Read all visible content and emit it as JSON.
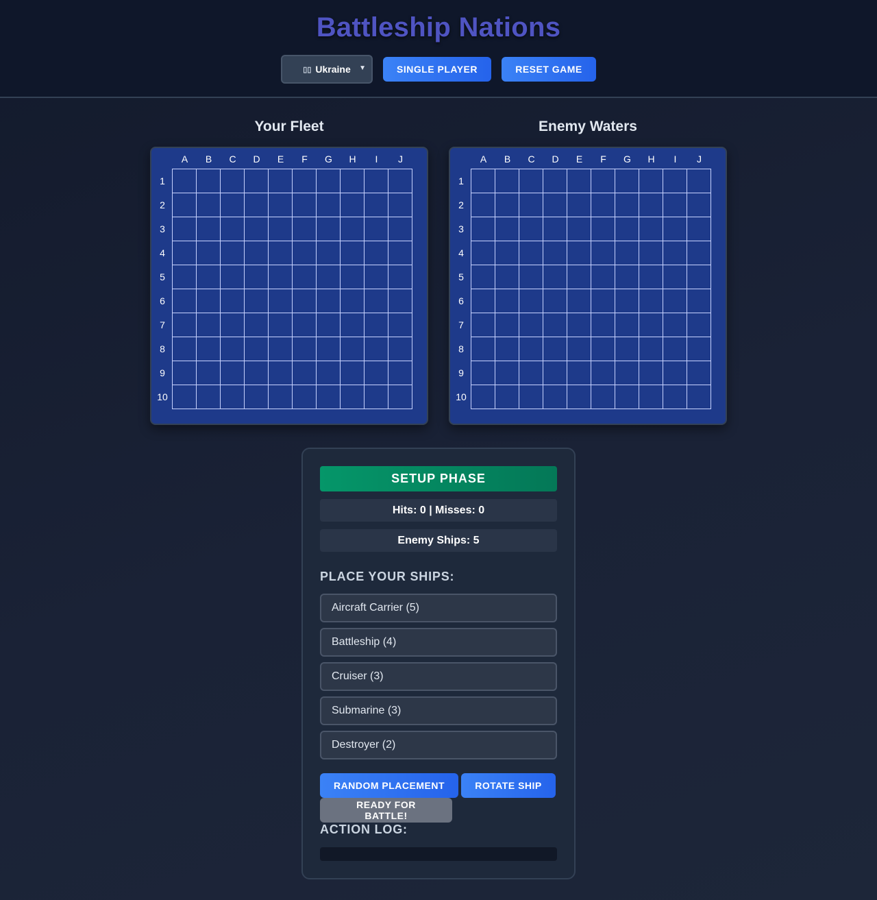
{
  "app": {
    "title": "Battleship Nations"
  },
  "header": {
    "nation_select": {
      "flag_glyph": "▯▯",
      "selected": "Ukraine"
    },
    "single_player_label": "SINGLE PLAYER",
    "reset_label": "RESET GAME"
  },
  "boards": {
    "columns": [
      "A",
      "B",
      "C",
      "D",
      "E",
      "F",
      "G",
      "H",
      "I",
      "J"
    ],
    "rows": [
      "1",
      "2",
      "3",
      "4",
      "5",
      "6",
      "7",
      "8",
      "9",
      "10"
    ],
    "player_title": "Your Fleet",
    "enemy_title": "Enemy Waters"
  },
  "panel": {
    "phase": "SETUP PHASE",
    "score": "Hits: 0 | Misses: 0",
    "enemy_ships": "Enemy Ships: 5",
    "place_heading": "PLACE YOUR SHIPS:",
    "ships": [
      "Aircraft Carrier (5)",
      "Battleship (4)",
      "Cruiser (3)",
      "Submarine (3)",
      "Destroyer (2)"
    ],
    "random_label": "RANDOM PLACEMENT",
    "rotate_label": "ROTATE SHIP",
    "ready_label": "READY FOR BATTLE!",
    "log_heading": "ACTION LOG:"
  },
  "colors": {
    "title": "#4f54c2",
    "board_water": "#1e3a8a",
    "button_blue": "#3b82f6",
    "phase_green": "#059669",
    "ready_gray": "#6b7280"
  }
}
